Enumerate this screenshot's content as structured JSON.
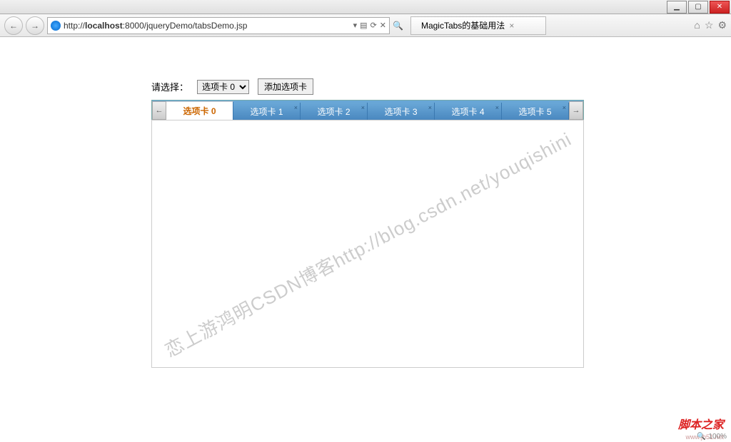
{
  "window": {
    "min": "▁",
    "max": "▢",
    "close": "✕"
  },
  "nav": {
    "back": "←",
    "fwd": "→"
  },
  "url": {
    "prefix": "http://",
    "host": "localhost",
    "rest": ":8000/jqueryDemo/tabsDemo.jsp",
    "drop": "▾",
    "refresh": "⟳",
    "stop": "✕",
    "search": "🔍"
  },
  "pagetab": {
    "title": "MagicTabs的基础用法",
    "close": "×"
  },
  "ricons": {
    "home": "⌂",
    "star": "☆",
    "gear": "⚙"
  },
  "controls": {
    "label": "请选择：",
    "selected": "选项卡 0",
    "addbtn": "添加选项卡"
  },
  "tabs": {
    "scrollLeft": "←",
    "scrollRight": "→",
    "items": [
      {
        "label": "选项卡 0",
        "active": true
      },
      {
        "label": "选项卡 1",
        "active": false
      },
      {
        "label": "选项卡 2",
        "active": false
      },
      {
        "label": "选项卡 3",
        "active": false
      },
      {
        "label": "选项卡 4",
        "active": false
      },
      {
        "label": "选项卡 5",
        "active": false
      }
    ],
    "closex": "×"
  },
  "watermark": "恋上游鸿明CSDN博客http://blog.csdn.net/youqishini",
  "branding": {
    "logo": "脚本之家",
    "url": "www.jb51.net"
  },
  "statusbar": {
    "zoom": "100%",
    "icon": "🔍"
  }
}
